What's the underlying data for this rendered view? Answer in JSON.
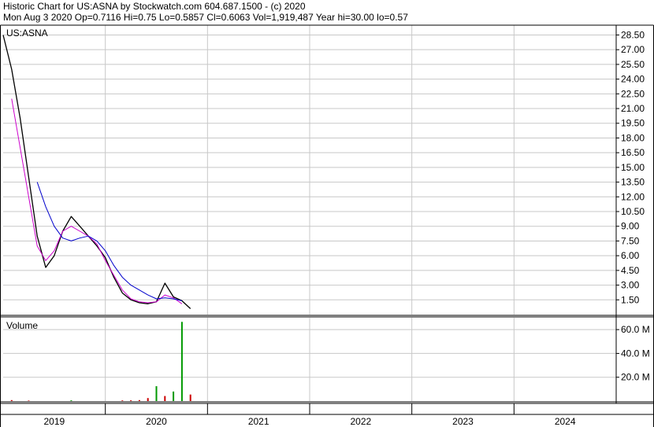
{
  "header": {
    "line1": "Historic Chart for US:ASNA by Stockwatch.com 604.687.1500 - (c) 2020",
    "line2": "Mon Aug  3 2020   Op=0.7116   Hi=0.75   Lo=0.5857   Cl=0.6063   Vol=1,919,487   Year hi=30.00   lo=0.57"
  },
  "colors": {
    "price": "#000000",
    "ma_short": "#cc00cc",
    "ma_long": "#0000cc",
    "volume_up": "#009900",
    "volume_down": "#cc0000",
    "grid": "#c8c8c8"
  },
  "chart_data": [
    {
      "type": "line",
      "title": "US:ASNA",
      "x_range": [
        "2018-10",
        "2024-10"
      ],
      "ylim": [
        0,
        29.5
      ],
      "y_ticks": [
        "28.50",
        "27.00",
        "25.50",
        "24.00",
        "22.50",
        "21.00",
        "19.50",
        "18.00",
        "16.50",
        "15.00",
        "13.50",
        "12.00",
        "10.50",
        "9.00",
        "7.50",
        "6.00",
        "4.50",
        "3.00",
        "1.50"
      ],
      "y_tick_values": [
        28.5,
        27,
        25.5,
        24,
        22.5,
        21,
        19.5,
        18,
        16.5,
        15,
        13.5,
        12,
        10.5,
        9,
        7.5,
        6,
        4.5,
        3,
        1.5
      ],
      "x_labels": [
        "2019",
        "2020",
        "2021",
        "2022",
        "2023",
        "2024"
      ],
      "x_label_dates": [
        "2019-04",
        "2020-04",
        "2021-04",
        "2022-04",
        "2023-04",
        "2024-04"
      ],
      "year_boundaries": [
        "2019-10",
        "2020-10",
        "2021-10",
        "2022-10",
        "2023-10"
      ],
      "grid": true,
      "series": [
        {
          "role": "price",
          "x": [
            "2018-10",
            "2018-11",
            "2018-12",
            "2019-01",
            "2019-02",
            "2019-03",
            "2019-04",
            "2019-05",
            "2019-06",
            "2019-07",
            "2019-08",
            "2019-09",
            "2019-10",
            "2019-11",
            "2019-12",
            "2020-01",
            "2020-02",
            "2020-03",
            "2020-04",
            "2020-05",
            "2020-06",
            "2020-07",
            "2020-08"
          ],
          "values": [
            28.5,
            25,
            20,
            14,
            8,
            4.8,
            6,
            8.5,
            10,
            9,
            8,
            7,
            5.8,
            3.8,
            2.2,
            1.5,
            1.2,
            1.1,
            1.3,
            3.2,
            1.8,
            1.4,
            0.6
          ]
        },
        {
          "role": "ma_short",
          "x": [
            "2018-11",
            "2018-12",
            "2019-01",
            "2019-02",
            "2019-03",
            "2019-04",
            "2019-05",
            "2019-06",
            "2019-07",
            "2019-08",
            "2019-09",
            "2019-10",
            "2019-11",
            "2019-12",
            "2020-01",
            "2020-02",
            "2020-03",
            "2020-04",
            "2020-05",
            "2020-06",
            "2020-07"
          ],
          "values": [
            22,
            17,
            12,
            7,
            5.5,
            6.5,
            8.5,
            9,
            8.5,
            8,
            7.2,
            5.5,
            4,
            2.5,
            1.6,
            1.3,
            1.2,
            1.3,
            2,
            1.7,
            1.1
          ]
        },
        {
          "role": "ma_long",
          "x": [
            "2019-02",
            "2019-03",
            "2019-04",
            "2019-05",
            "2019-06",
            "2019-07",
            "2019-08",
            "2019-09",
            "2019-10",
            "2019-11",
            "2019-12",
            "2020-01",
            "2020-02",
            "2020-03",
            "2020-04",
            "2020-05",
            "2020-06",
            "2020-07"
          ],
          "values": [
            13.5,
            11,
            9,
            7.8,
            7.5,
            7.8,
            8,
            7.5,
            6.5,
            5,
            3.8,
            3,
            2.5,
            2,
            1.6,
            1.7,
            1.6,
            1.4
          ]
        }
      ]
    },
    {
      "type": "bar",
      "title": "Volume",
      "ylim": [
        0,
        70
      ],
      "y_ticks": [
        "60.0 M",
        "40.0 M",
        "20.0 M"
      ],
      "y_tick_values": [
        60,
        40,
        20
      ],
      "bars": [
        {
          "x": "2018-11",
          "value": 0.8,
          "dir": "down"
        },
        {
          "x": "2019-01",
          "value": 0.4,
          "dir": "down"
        },
        {
          "x": "2019-06",
          "value": 0.6,
          "dir": "up"
        },
        {
          "x": "2019-12",
          "value": 0.5,
          "dir": "down"
        },
        {
          "x": "2020-01",
          "value": 0.6,
          "dir": "down"
        },
        {
          "x": "2020-02",
          "value": 0.8,
          "dir": "down"
        },
        {
          "x": "2020-03",
          "value": 2.5,
          "dir": "down"
        },
        {
          "x": "2020-04",
          "value": 12.5,
          "dir": "up"
        },
        {
          "x": "2020-05",
          "value": 4.2,
          "dir": "down"
        },
        {
          "x": "2020-06",
          "value": 8.0,
          "dir": "up"
        },
        {
          "x": "2020-07",
          "value": 66.5,
          "dir": "up"
        },
        {
          "x": "2020-08",
          "value": 5.5,
          "dir": "down"
        }
      ]
    }
  ]
}
